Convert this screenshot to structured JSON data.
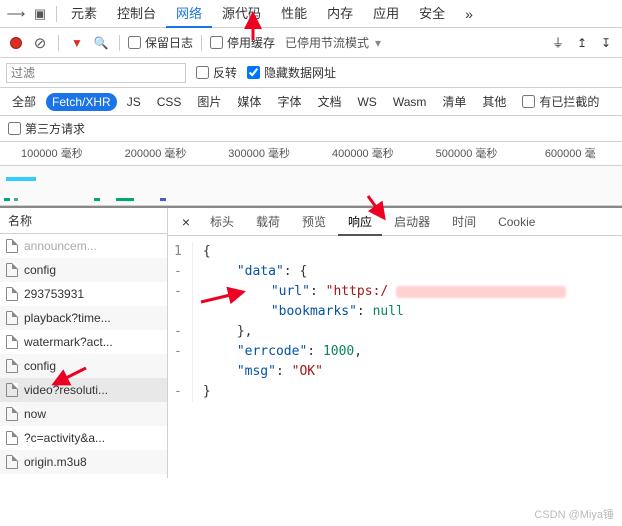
{
  "tabs": {
    "elements": "元素",
    "console": "控制台",
    "network": "网络",
    "sources": "源代码",
    "performance": "性能",
    "memory": "内存",
    "application": "应用",
    "security": "安全",
    "more": "»"
  },
  "toolbar": {
    "preserve_log": "保留日志",
    "disable_cache": "停用缓存",
    "throttling": "已停用节流模式"
  },
  "filter": {
    "placeholder": "过滤",
    "invert": "反转",
    "hide_data_urls": "隐藏数据网址"
  },
  "types": {
    "all": "全部",
    "fetchxhr": "Fetch/XHR",
    "js": "JS",
    "css": "CSS",
    "img": "图片",
    "media": "媒体",
    "font": "字体",
    "doc": "文档",
    "ws": "WS",
    "wasm": "Wasm",
    "manifest": "清单",
    "other": "其他",
    "blocked": "有已拦截的"
  },
  "thirdparty": "第三方请求",
  "timeline": [
    "100000 毫秒",
    "200000 毫秒",
    "300000 毫秒",
    "400000 毫秒",
    "500000 毫秒",
    "600000 毫"
  ],
  "name_label": "名称",
  "requests": [
    "config",
    "293753931",
    "playback?time...",
    "watermark?act...",
    "config",
    "video?resoluti...",
    "now",
    "?c=activity&a...",
    "origin.m3u8"
  ],
  "selected_index": 5,
  "subtabs": {
    "headers": "标头",
    "payload": "载荷",
    "preview": "预览",
    "response": "响应",
    "initiator": "启动器",
    "timing": "时间",
    "cookie": "Cookie"
  },
  "response": {
    "line1": "1",
    "body": {
      "open": "{",
      "data_key": "\"data\"",
      "data_open": ": {",
      "url_key": "\"url\"",
      "url_val": "\"https:/",
      "bookmarks_key": "\"bookmarks\"",
      "bookmarks_val": "null",
      "close_data": "},",
      "errcode_key": "\"errcode\"",
      "errcode_val": "1000",
      "msg_key": "\"msg\"",
      "msg_val": "\"OK\"",
      "close_obj": "}"
    }
  },
  "footer": "CSDN @Miya锤"
}
